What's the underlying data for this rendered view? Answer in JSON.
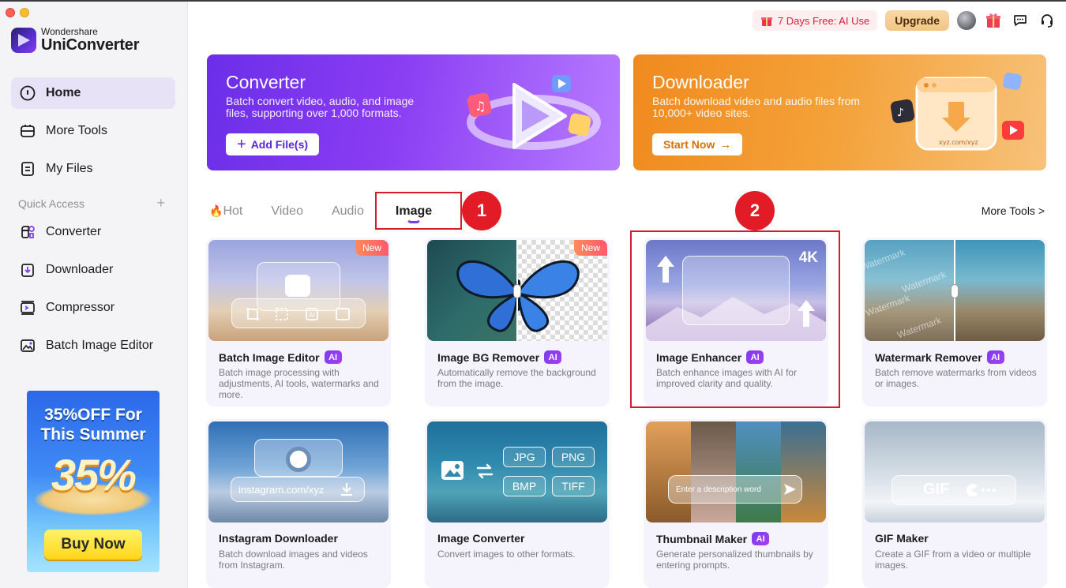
{
  "app": {
    "brand_sub": "Wondershare",
    "brand_name": "UniConverter"
  },
  "sidebar": {
    "nav": [
      {
        "label": "Home",
        "icon": "home-icon"
      },
      {
        "label": "More Tools",
        "icon": "toolbox-icon"
      },
      {
        "label": "My Files",
        "icon": "files-icon"
      }
    ],
    "quick_access_label": "Quick Access",
    "quick_access": [
      {
        "label": "Converter",
        "icon": "converter-icon"
      },
      {
        "label": "Downloader",
        "icon": "downloader-icon"
      },
      {
        "label": "Compressor",
        "icon": "compressor-icon"
      },
      {
        "label": "Batch Image Editor",
        "icon": "image-editor-icon"
      }
    ],
    "promo": {
      "title_line1": "35%OFF For",
      "title_line2": "This Summer",
      "big_text": "35%",
      "button": "Buy Now"
    }
  },
  "topbar": {
    "free_trial": "7 Days Free: AI Use",
    "upgrade": "Upgrade"
  },
  "banners": {
    "converter": {
      "title": "Converter",
      "desc": "Batch convert video, audio, and image files, supporting over 1,000 formats.",
      "button": "Add File(s)"
    },
    "downloader": {
      "title": "Downloader",
      "desc": "Batch download video and audio files from 10,000+ video sites.",
      "button": "Start Now",
      "art_url": "xyz.com/xyz"
    }
  },
  "tabs": [
    {
      "label": "Hot",
      "icon": "fire-icon"
    },
    {
      "label": "Video"
    },
    {
      "label": "Audio"
    },
    {
      "label": "Image"
    }
  ],
  "more_tools": "More Tools >",
  "annotations": [
    "1",
    "2"
  ],
  "cards": [
    {
      "title": "Batch Image Editor",
      "ai": "AI",
      "badge": "New",
      "desc": "Batch image processing with adjustments, AI tools, watermarks and more."
    },
    {
      "title": "Image BG Remover",
      "ai": "AI",
      "badge": "New",
      "desc": "Automatically remove the background from the image."
    },
    {
      "title": "Image Enhancer",
      "ai": "AI",
      "badge_4k": "4K",
      "desc": "Batch enhance images with AI for improved clarity and quality."
    },
    {
      "title": "Watermark Remover",
      "ai": "AI",
      "watermark_text": "Watermark",
      "desc": "Batch remove watermarks from videos or images."
    },
    {
      "title": "Instagram Downloader",
      "url": "instagram.com/xyz",
      "desc": "Batch download images and videos from Instagram."
    },
    {
      "title": "Image Converter",
      "formats": [
        "JPG",
        "PNG",
        "BMP",
        "TIFF"
      ],
      "desc": "Convert images to other formats."
    },
    {
      "title": "Thumbnail Maker",
      "ai": "AI",
      "prompt": "Enter a description word",
      "desc": "Generate personalized thumbnails by entering prompts."
    },
    {
      "title": "GIF Maker",
      "gif_label": "GIF",
      "desc": "Create a GIF from a video or multiple images."
    }
  ],
  "colors": {
    "accent": "#7a3cf0",
    "annotation_red": "#e21c27",
    "converter_banner": "#7b35ee",
    "downloader_banner": "#f29a30"
  }
}
